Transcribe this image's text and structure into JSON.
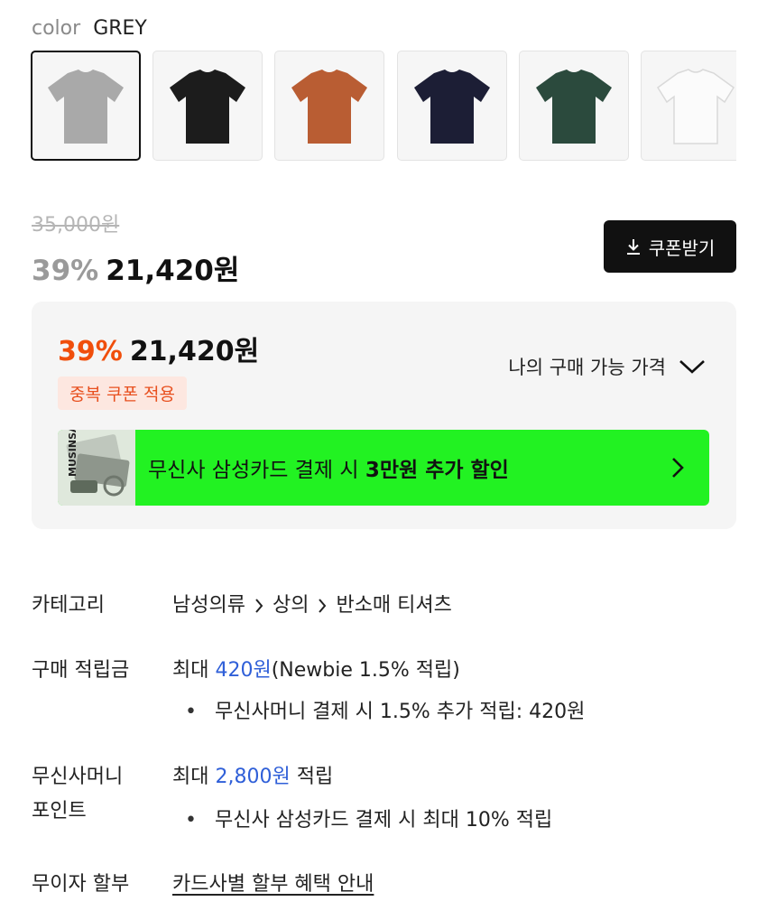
{
  "color_selector": {
    "label": "color",
    "selected": "GREY",
    "swatches": [
      {
        "name": "grey",
        "color": "#a9a9a9",
        "selected": true
      },
      {
        "name": "black",
        "color": "#1c1c1c",
        "selected": false
      },
      {
        "name": "orange",
        "color": "#b95d33",
        "selected": false
      },
      {
        "name": "navy",
        "color": "#1c1e35",
        "selected": false
      },
      {
        "name": "green",
        "color": "#2b4a3d",
        "selected": false
      },
      {
        "name": "white",
        "color": "#fbfbfb",
        "selected": false
      }
    ]
  },
  "price": {
    "original": "35,000원",
    "discount_pct": "39%",
    "sale": "21,420원"
  },
  "coupon_button": {
    "label": "쿠폰받기",
    "icon": "download-icon"
  },
  "my_price": {
    "discount_pct": "39%",
    "price": "21,420원",
    "badge": "중복 쿠폰 적용",
    "toggle_label": "나의 구매 가능 가격",
    "toggle_icon": "chevron-down-icon"
  },
  "card_banner": {
    "text": "무신사 삼성카드 결제 시",
    "text_bold": "3만원 추가 할인",
    "thumb_text": "MUSINSA",
    "bg_color": "#22f222",
    "icon": "chevron-right-icon"
  },
  "info": {
    "category": {
      "key": "카테고리",
      "crumbs": [
        "남성의류",
        "상의",
        "반소매 티셔츠"
      ]
    },
    "points": {
      "key": "구매 적립금",
      "prefix": "최대",
      "amount": "420원",
      "suffix": "(Newbie 1.5% 적립)",
      "bullet": "무신사머니 결제 시 1.5% 추가 적립: 420원"
    },
    "money": {
      "key_line1": "무신사머니",
      "key_line2": "포인트",
      "prefix": "최대",
      "amount": "2,800원",
      "suffix": "적립",
      "bullet": "무신사 삼성카드 결제 시 최대 10% 적립"
    },
    "installment": {
      "key": "무이자 할부",
      "link": "카드사별 할부 혜택 안내"
    }
  },
  "accent_colors": {
    "discount_orange": "#f04e0b",
    "link_blue": "#2f5fd8"
  }
}
